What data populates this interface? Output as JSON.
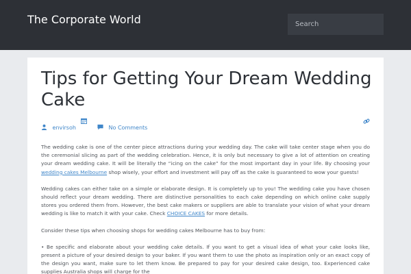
{
  "site": {
    "title": "The Corporate World"
  },
  "search": {
    "placeholder": "Search"
  },
  "post": {
    "title": "Tips for Getting Your Dream Wedding Cake",
    "author": "envirsoh",
    "comments": "No Comments",
    "paragraphs": [
      {
        "before": "The wedding cake is one of the center piece attractions during your wedding day. The cake will take center stage when you do the ceremonial slicing as part of the wedding celebration. Hence, it is only but necessary to give a lot of attention on creating your dream wedding cake. It will be literally the “icing on the cake” for the most important day in your life. By choosing your ",
        "link": "wedding cakes Melbourne",
        "after": " shop wisely, your effort and investment will pay off as the cake is guaranteed to wow your guests!"
      },
      {
        "before": "Wedding cakes can either take on a simple or elaborate design. It is completely up to you! The wedding cake you have chosen should reflect your dream wedding. There are distinctive personalities to each cake depending on which online cake supply stores you ordered them from. However, the best cake makers or suppliers are able to translate your vision of what your dream wedding is like to match it with your cake. Check ",
        "link": "CHOICE CAKES",
        "after": " for more details."
      },
      {
        "text": "Consider these tips when choosing shops for wedding cakes Melbourne has to buy from:"
      },
      {
        "text": "• Be specific and elaborate about your wedding cake details. If you want to get a visual idea of what your cake looks like, present a picture of your desired design to your baker. If you want them to use the photo as inspiration only or an exact copy of the design you want, make sure to let them know. Be prepared to pay for your desired cake design, too. Experienced cake supplies Australia shops will charge for the"
      }
    ]
  },
  "colors": {
    "header": "#2d3036",
    "link": "#3f86c9",
    "background": "#e9ebee"
  },
  "icons": {
    "author": "user-icon",
    "date": "calendar-icon",
    "comments": "comment-icon",
    "permalink": "link-icon"
  }
}
